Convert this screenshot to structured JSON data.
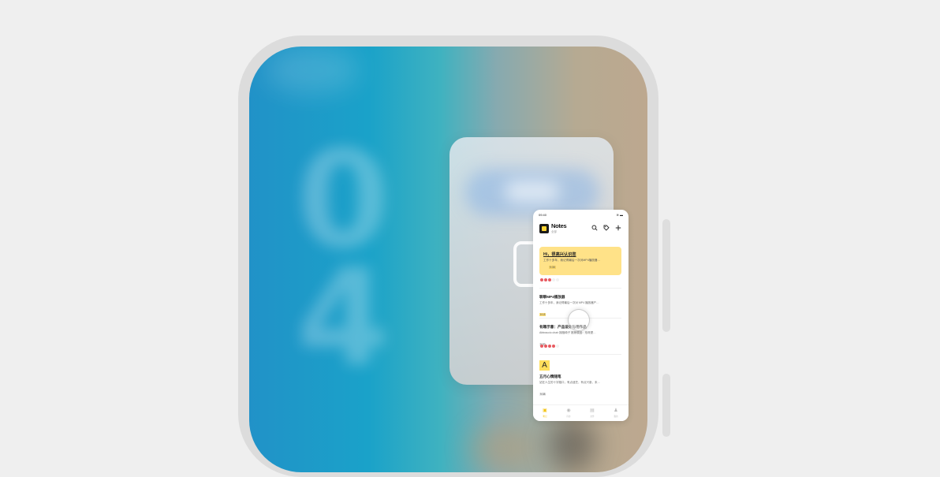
{
  "status_bar": {
    "time": "09:40",
    "icons": "wifi-icon battery-icon"
  },
  "header": {
    "title": "Notes",
    "subtitle": "全部"
  },
  "highlight_card": {
    "title": "Hi，很高兴认识您",
    "body": "工作十多年，我记得最后一次对MP4播放器…",
    "date": "9:38",
    "dots": [
      true,
      true,
      true,
      false,
      false
    ]
  },
  "notes": [
    {
      "title": "聊聊MP4播放器",
      "body": "工作十多年，我记得最后一次对 MP4 播放器产…",
      "date": "8:18",
      "date_style": "yellow"
    },
    {
      "title": "有趣示意：产品设计与用作品",
      "body": "Abbraccio chair 拥抱椅子 推荐原因：形荷提…",
      "date": "9:20",
      "date_style": "grey",
      "dots": [
        true,
        true,
        true,
        true,
        false
      ]
    },
    {
      "badge": "A",
      "title": "五月心情随笔",
      "body": "站在人生的十字路口，有点迷茫，有点兴奋，未…",
      "date": "9:38",
      "date_style": "grey"
    }
  ],
  "tabs": [
    {
      "icon": "▣",
      "label": "笔记",
      "active": true
    },
    {
      "icon": "◉",
      "label": "待办",
      "active": false
    },
    {
      "icon": "▤",
      "label": "文件",
      "active": false
    },
    {
      "icon": "♟",
      "label": "我的",
      "active": false
    }
  ]
}
